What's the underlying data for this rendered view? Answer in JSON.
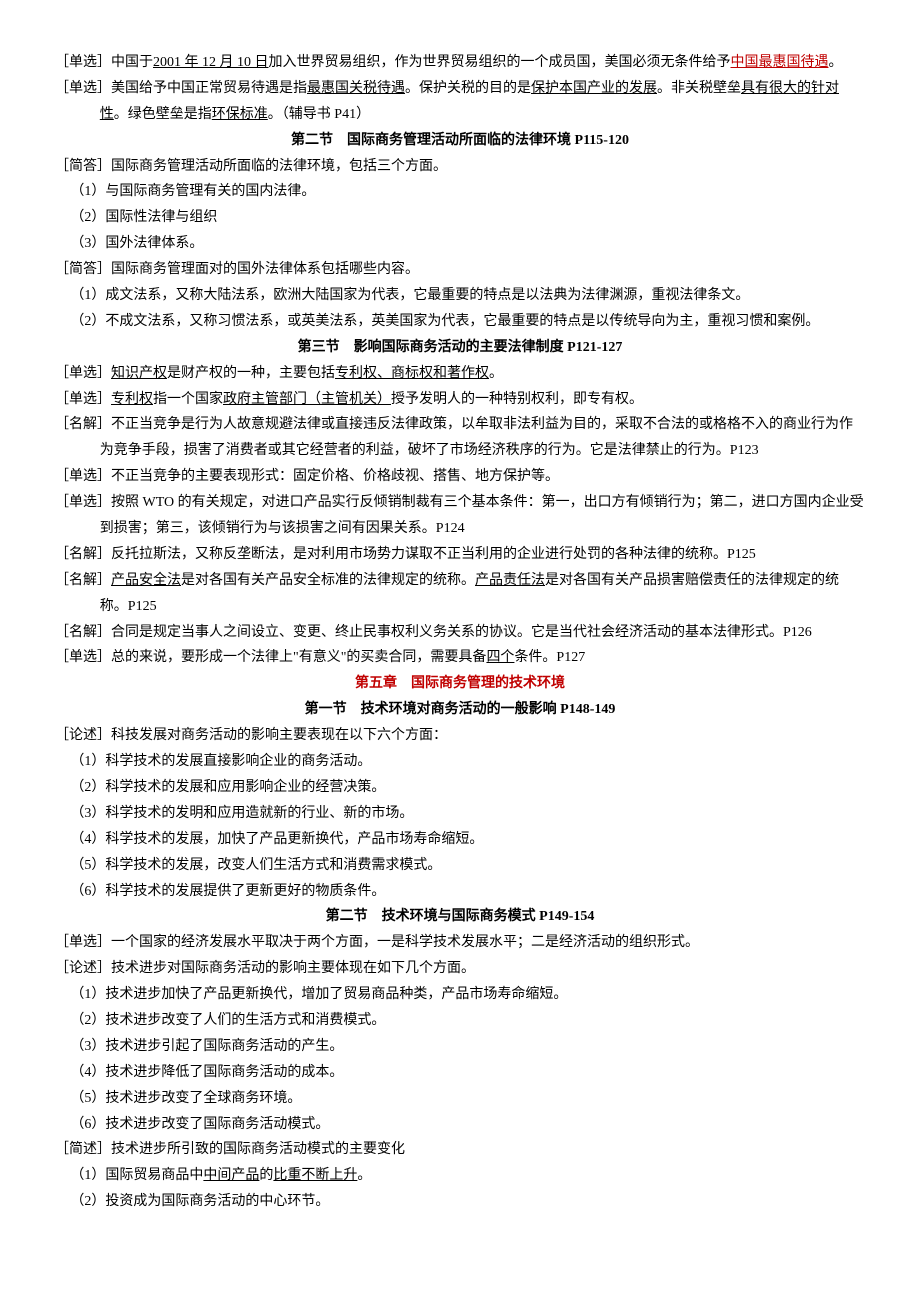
{
  "p1_pre": "［单选］中国于",
  "p1_u1": "2001 年 12 月 10 日",
  "p1_mid": "加入世界贸易组织，作为世界贸易组织的一个成员国，美国必须无条件给予",
  "p1_u2a": "中国",
  "p1_u2b": "最惠国待遇",
  "p1_end": "。",
  "p2_pre": "［单选］美国给予中国正常贸易待遇是指",
  "p2_u1": "最惠国关税待遇",
  "p2_m1": "。保护关税的目的是",
  "p2_u2": "保护本国产业的发展",
  "p2_m2": "。非关税壁垒",
  "p2_u3": "具有很大的针对性",
  "p2_m3": "。绿色壁垒是指",
  "p2_u4": "环保标准",
  "p2_end": "。（辅导书 P41）",
  "h_s2": "第二节　国际商务管理活动所面临的法律环境 P115-120",
  "p3": "［简答］国际商务管理活动所面临的法律环境，包括三个方面。",
  "p3_1": "（1）与国际商务管理有关的国内法律。",
  "p3_2": "（2）国际性法律与组织",
  "p3_3": "（3）国外法律体系。",
  "p4": "［简答］国际商务管理面对的国外法律体系包括哪些内容。",
  "p4_1": "（1）成文法系，又称大陆法系，欧洲大陆国家为代表，它最重要的特点是以法典为法律渊源，重视法律条文。",
  "p4_2": "（2）不成文法系，又称习惯法系，或英美法系，英美国家为代表，它最重要的特点是以传统导向为主，重视习惯和案例。",
  "h_s3": "第三节　影响国际商务活动的主要法律制度 P121-127",
  "p5_pre": "［单选］",
  "p5_u1": "知识产权",
  "p5_m1": "是财产权的一种，主要包括",
  "p5_u2": "专利权、商标权和著作权",
  "p5_end": "。",
  "p6_pre": "［单选］",
  "p6_u1": "专利权",
  "p6_m1": "指一个国家",
  "p6_u2": "政府主管部门（主管机关）",
  "p6_end": "授予发明人的一种特别权利，即专有权。",
  "p7": "［名解］不正当竞争是行为人故意规避法律或直接违反法律政策，以牟取非法利益为目的，采取不合法的或格格不入的商业行为作为竞争手段，损害了消费者或其它经营者的利益，破坏了市场经济秩序的行为。它是法律禁止的行为。P123",
  "p8": "［单选］不正当竞争的主要表现形式：固定价格、价格歧视、搭售、地方保护等。",
  "p9": "［单选］按照 WTO 的有关规定，对进口产品实行反倾销制裁有三个基本条件：第一，出口方有倾销行为；第二，进口方国内企业受到损害；第三，该倾销行为与该损害之间有因果关系。P124",
  "p10": "［名解］反托拉斯法，又称反垄断法，是对利用市场势力谋取不正当利用的企业进行处罚的各种法律的统称。P125",
  "p11_pre": "［名解］",
  "p11_u1": "产品安全法",
  "p11_m1": "是对各国有关产品安全标准的法律规定的统称。",
  "p11_u2": "产品责任法",
  "p11_end": "是对各国有关产品损害赔偿责任的法律规定的统称。P125",
  "p12": "［名解］合同是规定当事人之间设立、变更、终止民事权利义务关系的协议。它是当代社会经济活动的基本法律形式。P126",
  "p13_pre": "［单选］总的来说，要形成一个法律上\"有意义\"的买卖合同，需要具备",
  "p13_u1": "四个",
  "p13_end": "条件。P127",
  "h_ch5": "第五章　国际商务管理的技术环境",
  "h_s1b": "第一节　技术环境对商务活动的一般影响 P148-149",
  "p14": "［论述］科技发展对商务活动的影响主要表现在以下六个方面：",
  "p14_1": "（1）科学技术的发展直接影响企业的商务活动。",
  "p14_2": "（2）科学技术的发展和应用影响企业的经营决策。",
  "p14_3": "（3）科学技术的发明和应用造就新的行业、新的市场。",
  "p14_4": "（4）科学技术的发展，加快了产品更新换代，产品市场寿命缩短。",
  "p14_5": "（5）科学技术的发展，改变人们生活方式和消费需求模式。",
  "p14_6": "（6）科学技术的发展提供了更新更好的物质条件。",
  "h_s2b": "第二节　技术环境与国际商务模式 P149-154",
  "p15": "［单选］一个国家的经济发展水平取决于两个方面，一是科学技术发展水平；二是经济活动的组织形式。",
  "p16": "［论述］技术进步对国际商务活动的影响主要体现在如下几个方面。",
  "p16_1": "（1）技术进步加快了产品更新换代，增加了贸易商品种类，产品市场寿命缩短。",
  "p16_2": "（2）技术进步改变了人们的生活方式和消费模式。",
  "p16_3": "（3）技术进步引起了国际商务活动的产生。",
  "p16_4": "（4）技术进步降低了国际商务活动的成本。",
  "p16_5": "（5）技术进步改变了全球商务环境。",
  "p16_6": "（6）技术进步改变了国际商务活动模式。",
  "p17": "［简述］技术进步所引致的国际商务活动模式的主要变化",
  "p17_1_pre": "（1）国际贸易商品中",
  "p17_1_u": "中间产品",
  "p17_1_m": "的",
  "p17_1_u2": "比重不断上升",
  "p17_1_end": "。",
  "p17_2": "（2）投资成为国际商务活动的中心环节。"
}
